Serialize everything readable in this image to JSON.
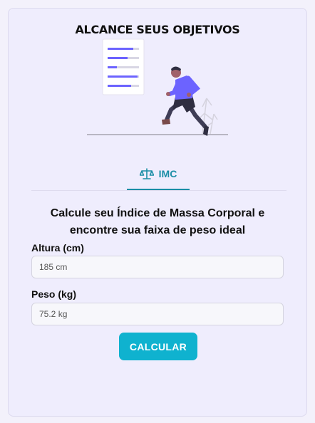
{
  "header": {
    "title": "ALCANCE SEUS OBJETIVOS"
  },
  "illustration": {
    "icon": "runner-illustration"
  },
  "tabs": [
    {
      "label": "IMC",
      "icon": "scale-icon",
      "active": true
    }
  ],
  "form": {
    "intro": "Calcule seu Índice de Massa Corporal e encontre sua faixa de peso ideal",
    "height": {
      "label": "Altura (cm)",
      "value": "185 cm"
    },
    "weight": {
      "label": "Peso (kg)",
      "value": "75.2 kg"
    },
    "submit_label": "CALCULAR"
  },
  "colors": {
    "accent": "#0fb2cf",
    "tab": "#1b8ea6",
    "card_bg": "#efedfd",
    "illustration_purple": "#6c63ff"
  }
}
